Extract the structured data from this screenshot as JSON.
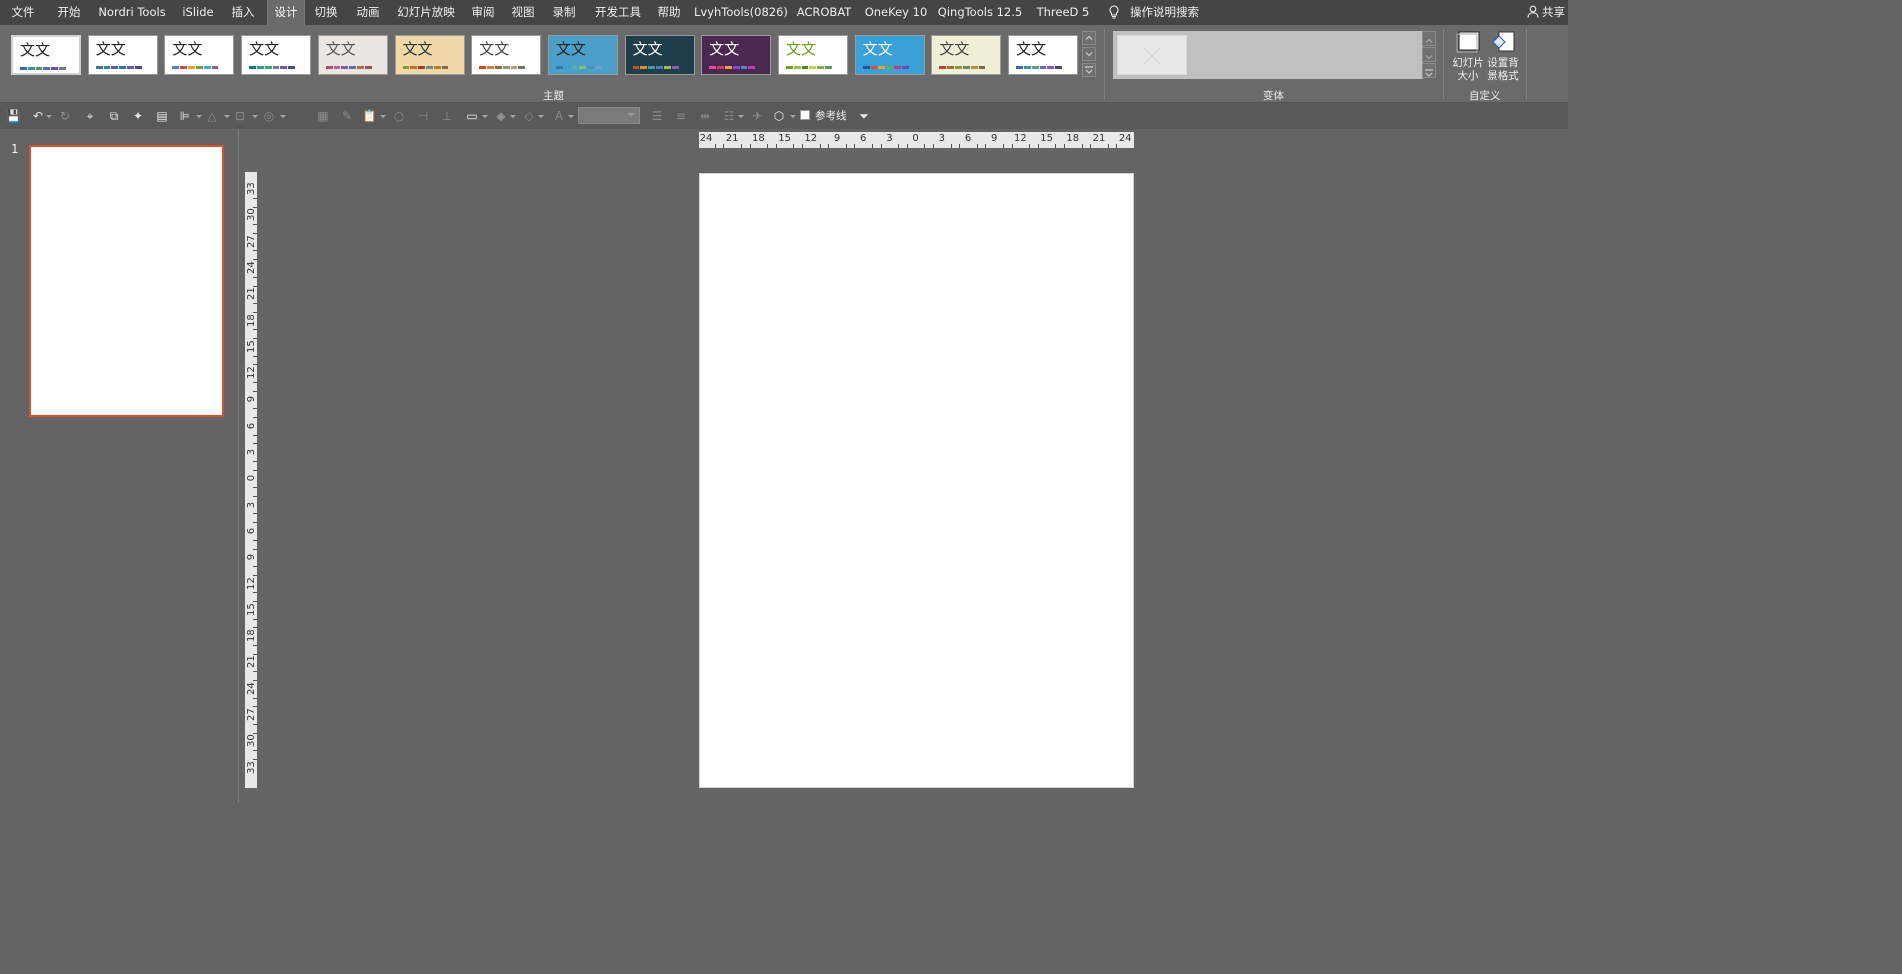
{
  "tabs": [
    {
      "label": "文件",
      "active": false
    },
    {
      "label": "开始",
      "active": false
    },
    {
      "label": "Nordri Tools",
      "active": false
    },
    {
      "label": "iSlide",
      "active": false
    },
    {
      "label": "插入",
      "active": false
    },
    {
      "label": "设计",
      "active": true
    },
    {
      "label": "切换",
      "active": false
    },
    {
      "label": "动画",
      "active": false
    },
    {
      "label": "幻灯片放映",
      "active": false
    },
    {
      "label": "审阅",
      "active": false
    },
    {
      "label": "视图",
      "active": false
    },
    {
      "label": "录制",
      "active": false
    },
    {
      "label": "开发工具",
      "active": false
    },
    {
      "label": "帮助",
      "active": false
    },
    {
      "label": "LvyhTools(0826)",
      "active": false
    },
    {
      "label": "ACROBAT",
      "active": false
    },
    {
      "label": "OneKey 10",
      "active": false
    },
    {
      "label": "QingTools 12.5",
      "active": false
    },
    {
      "label": "ThreeD 5",
      "active": false
    }
  ],
  "tell_me": {
    "label": "操作说明搜索",
    "icon": "lightbulb-icon"
  },
  "share": {
    "label": "共享",
    "icon": "person-icon"
  },
  "ribbon": {
    "themes_group_label": "主题",
    "variants_group_label": "变体",
    "customize_group_label": "自定义",
    "theme_sample_text": "文文",
    "themes": [
      {
        "name": "office",
        "bg": "#ffffff",
        "fg": "#222222",
        "colors": [
          "#2e6fa7",
          "#3a8f9e",
          "#4a9a5a",
          "#5b6bb0",
          "#6a4fa0",
          "#7a7a7a"
        ]
      },
      {
        "name": "office2",
        "bg": "#ffffff",
        "fg": "#222222",
        "colors": [
          "#3c7a9a",
          "#2b8a8a",
          "#5e5e9e",
          "#3e6ea0",
          "#6a5aa0",
          "#484890"
        ]
      },
      {
        "name": "facet",
        "bg": "#ffffff",
        "fg": "#222222",
        "colors": [
          "#5a7fbf",
          "#c0504d",
          "#f0a030",
          "#70a050",
          "#4aacc6",
          "#8064a2"
        ]
      },
      {
        "name": "integral",
        "bg": "#ffffff",
        "fg": "#222222",
        "colors": [
          "#1f6f8b",
          "#3a9a9a",
          "#4aa07a",
          "#6a7aa0",
          "#7a5aa0",
          "#4a4a8a"
        ]
      },
      {
        "name": "ion-boardroom",
        "bg": "#ece6e2",
        "fg": "#555555",
        "colors": [
          "#b04a70",
          "#c060a0",
          "#8060a0",
          "#6070a0",
          "#a07050",
          "#a05050"
        ]
      },
      {
        "name": "organic",
        "bg": "#f0d8a8",
        "fg": "#333333",
        "colors": [
          "#8a9a3a",
          "#c07030",
          "#a04030",
          "#6a8a8a",
          "#b08030",
          "#8a6a4a"
        ]
      },
      {
        "name": "retrospect",
        "bg": "#ffffff",
        "fg": "#444444",
        "colors": [
          "#c0502a",
          "#d0803a",
          "#a06a40",
          "#8a9a6a",
          "#b0a080",
          "#7a7060"
        ]
      },
      {
        "name": "slice",
        "bg": "#4aa0c8",
        "fg": "#222222",
        "colors": [
          "#2a7ab0",
          "#3aa0c0",
          "#5ab0a0",
          "#7ac080",
          "#4a90b0",
          "#6aa0d0"
        ]
      },
      {
        "name": "wisp",
        "bg": "#1f3e4a",
        "fg": "#ffffff",
        "colors": [
          "#d04a3a",
          "#e08a3a",
          "#3aa0a0",
          "#4a7ad0",
          "#a0c040",
          "#8a5ab0"
        ]
      },
      {
        "name": "berlin",
        "bg": "#4a2850",
        "fg": "#ffffff",
        "colors": [
          "#e04a9a",
          "#d03a6a",
          "#f0a040",
          "#8a4ad0",
          "#4a8ad0",
          "#c03ac0"
        ]
      },
      {
        "name": "ion",
        "bg": "#ffffff",
        "fg": "#6aa020",
        "colors": [
          "#6aa020",
          "#9ac040",
          "#4a8a30",
          "#c0d060",
          "#8ab040",
          "#5a9a5a"
        ]
      },
      {
        "name": "parallax",
        "bg": "#3aa0d8",
        "fg": "#ffffff",
        "colors": [
          "#1a5a9a",
          "#e04a3a",
          "#f0a030",
          "#5ab04a",
          "#c03a8a",
          "#6a4ab0"
        ]
      },
      {
        "name": "savon",
        "bg": "#f0f0d8",
        "fg": "#444444",
        "colors": [
          "#c04030",
          "#a07030",
          "#8a9a3a",
          "#6a8a5a",
          "#b09040",
          "#7a6a4a"
        ]
      },
      {
        "name": "dividend",
        "bg": "#ffffff",
        "fg": "#222222",
        "colors": [
          "#3a6ab0",
          "#3a9a9a",
          "#5aa07a",
          "#6a6ab0",
          "#8a5aa0",
          "#4a4a7a"
        ]
      }
    ],
    "slide_size": "幻灯片\n大小",
    "format_bg": "设置背\n景格式"
  },
  "qat": {
    "guides_label": "参考线",
    "font_size_value": ""
  },
  "slide_panel": {
    "slide_number": "1"
  },
  "rulers": {
    "horizontal": [
      "24",
      "21",
      "18",
      "15",
      "12",
      "9",
      "6",
      "3",
      "0",
      "3",
      "6",
      "9",
      "12",
      "15",
      "18",
      "21",
      "24"
    ],
    "vertical": [
      "33",
      "30",
      "27",
      "24",
      "21",
      "18",
      "15",
      "12",
      "9",
      "6",
      "3",
      "0",
      "3",
      "6",
      "9",
      "12",
      "15",
      "18",
      "21",
      "24",
      "27",
      "30",
      "33"
    ]
  },
  "colors": {
    "accent": "#d9502e",
    "ribbon": "#6a6a6a",
    "workspace": "#646464"
  }
}
